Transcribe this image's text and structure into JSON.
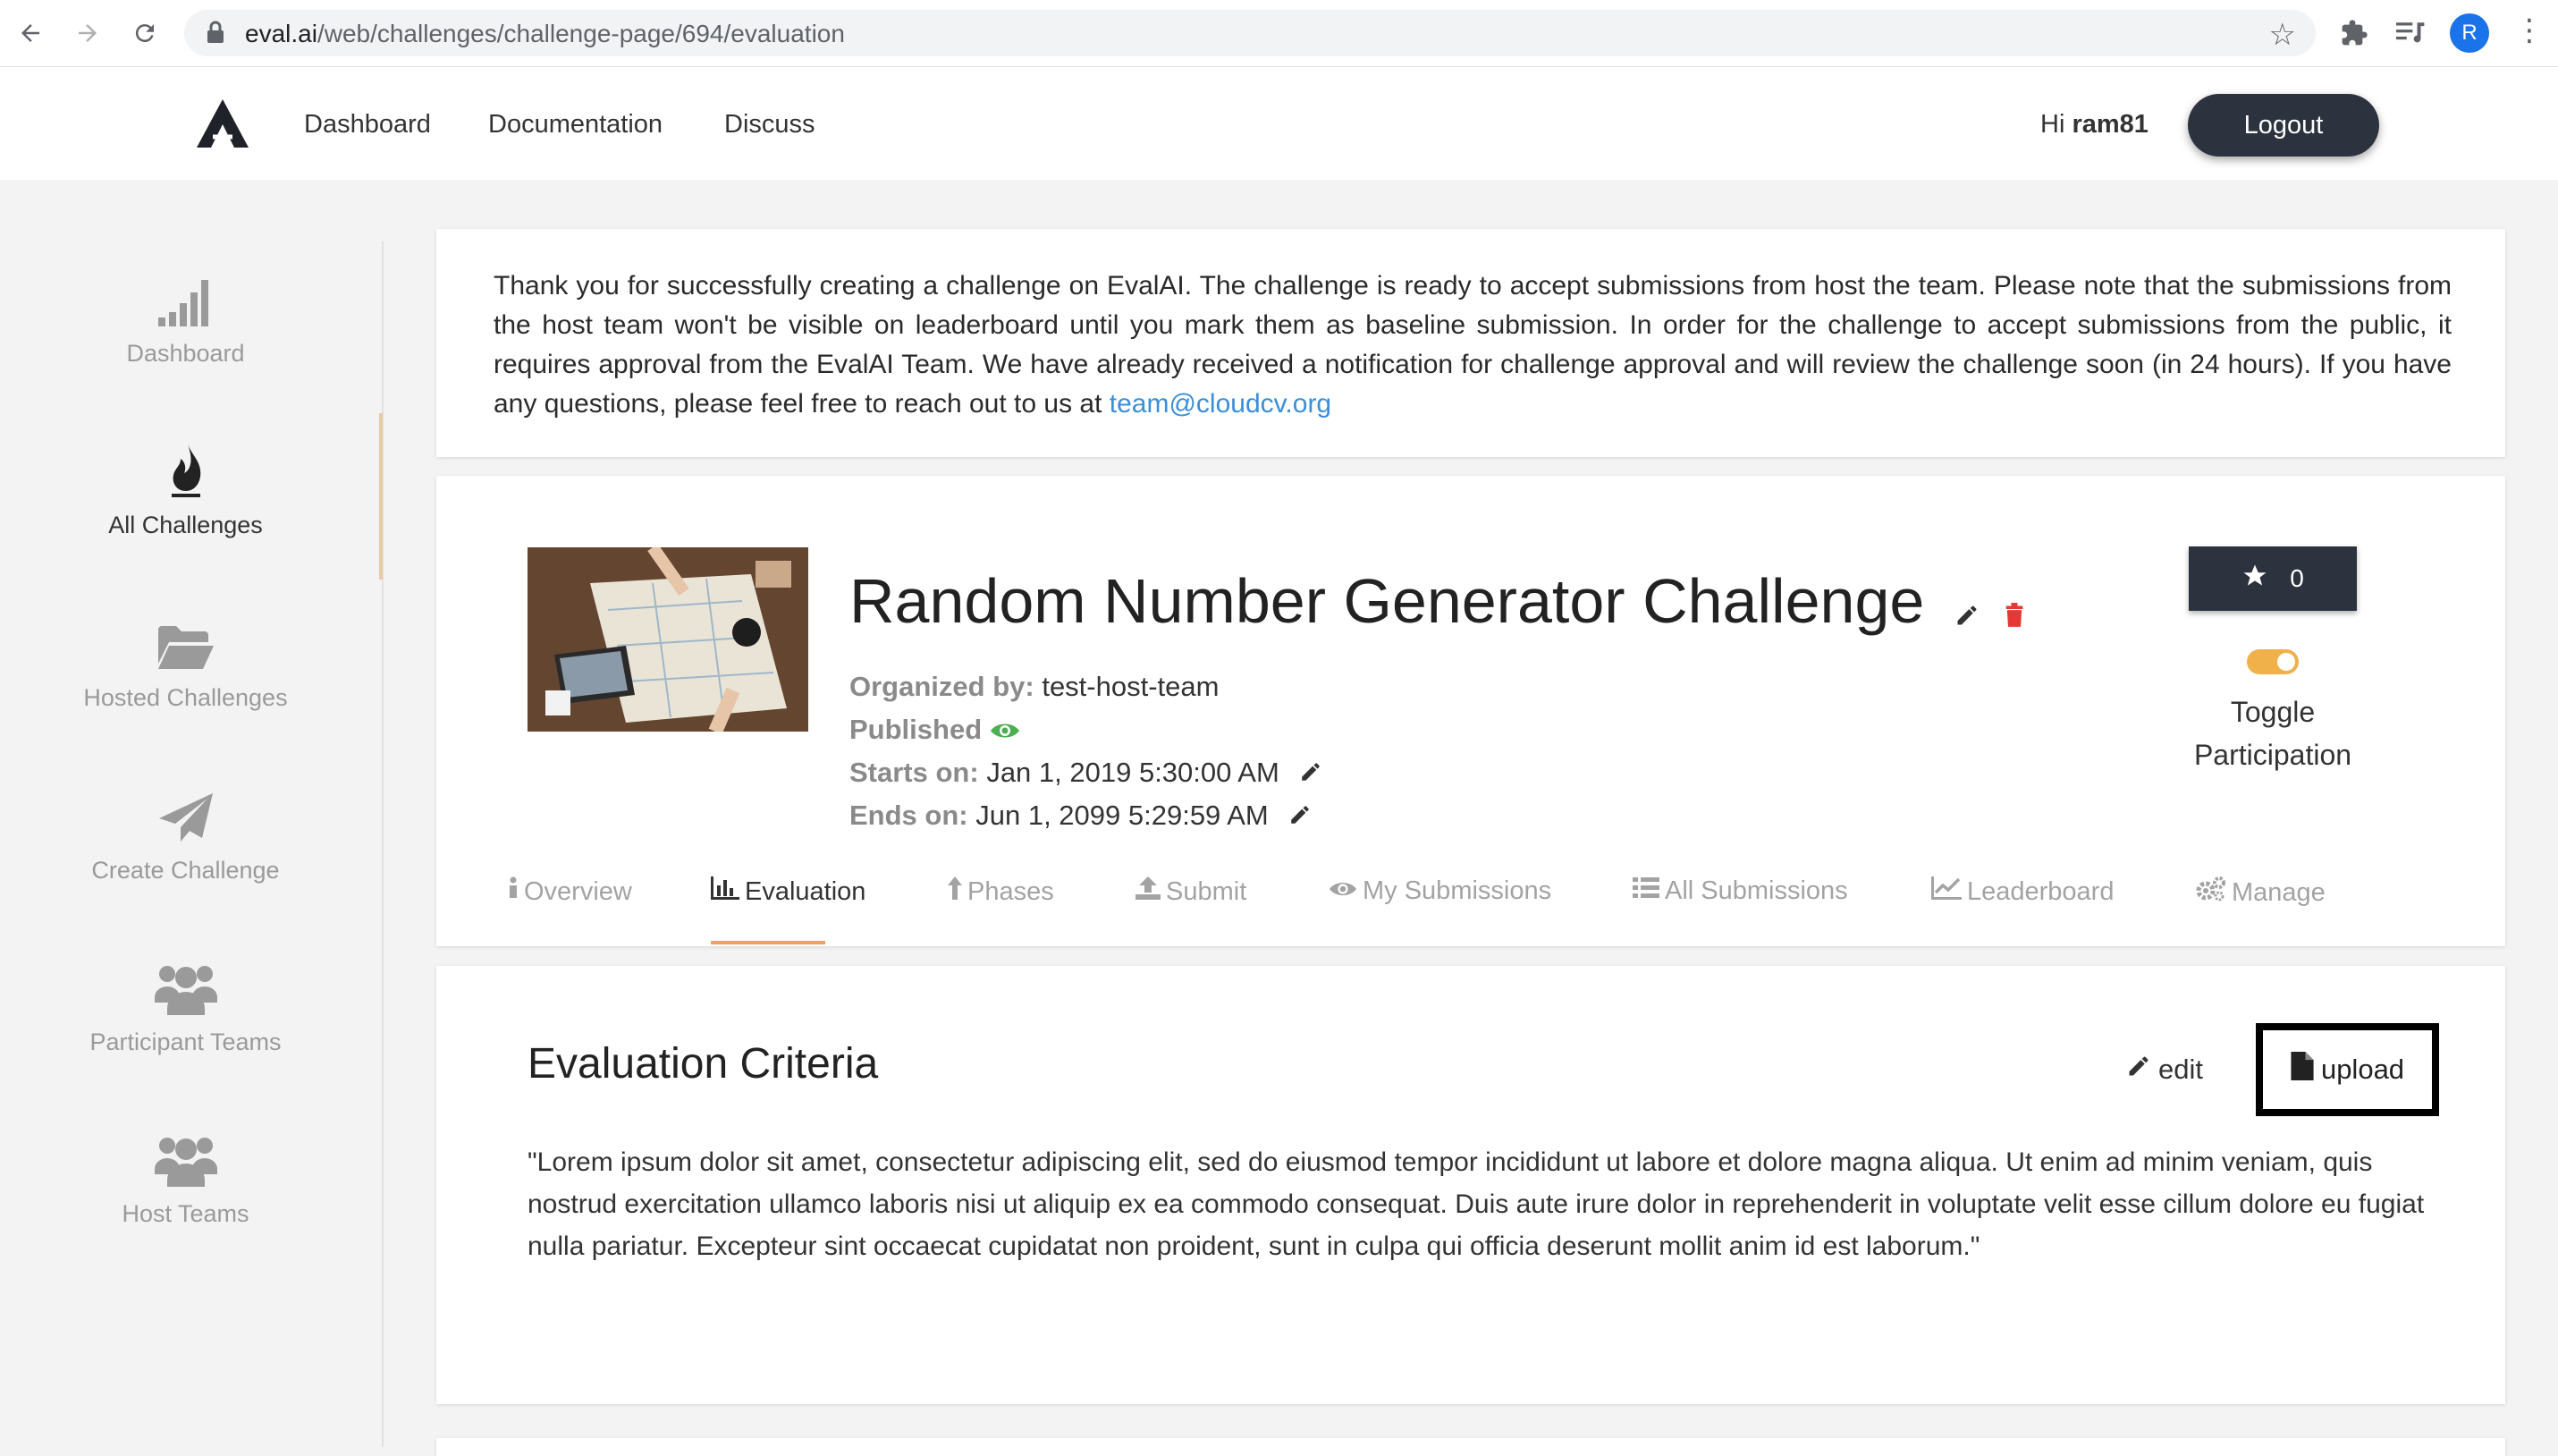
{
  "browser": {
    "url_host": "eval.ai",
    "url_path": "/web/challenges/challenge-page/694/evaluation",
    "profile_initial": "R"
  },
  "header": {
    "nav": [
      "Dashboard",
      "Documentation",
      "Discuss"
    ],
    "greeting_prefix": "Hi ",
    "username": "ram81",
    "logout_label": "Logout"
  },
  "sidebar": {
    "items": [
      {
        "label": "Dashboard",
        "icon": "signal-bars-icon"
      },
      {
        "label": "All Challenges",
        "icon": "fire-icon"
      },
      {
        "label": "Hosted Challenges",
        "icon": "folder-open-icon"
      },
      {
        "label": "Create Challenge",
        "icon": "paper-plane-icon"
      },
      {
        "label": "Participant Teams",
        "icon": "users-icon"
      },
      {
        "label": "Host Teams",
        "icon": "users-icon"
      }
    ]
  },
  "notice": {
    "text": "Thank you for successfully creating a challenge on EvalAI. The challenge is ready to accept submissions from host the team. Please note that the submissions from the host team won't be visible on leaderboard until you mark them as baseline submission. In order for the challenge to accept submissions from the public, it requires approval from the EvalAI Team. We have already received a notification for challenge approval and will review the challenge soon (in 24 hours). If you have any questions, please feel free to reach out to us at ",
    "email": "team@cloudcv.org"
  },
  "challenge": {
    "title": "Random Number Generator Challenge",
    "organized_by_key": "Organized by:",
    "organized_by": "test-host-team",
    "published_label": "Published",
    "starts_key": "Starts on:",
    "starts": "Jan 1, 2019 5:30:00 AM",
    "ends_key": "Ends on:",
    "ends": "Jun 1, 2099 5:29:59 AM",
    "star_count": "0",
    "toggle_line1": "Toggle",
    "toggle_line2": "Participation"
  },
  "tabs": [
    {
      "label": "Overview",
      "icon": "info-icon"
    },
    {
      "label": "Evaluation",
      "icon": "bar-chart-icon"
    },
    {
      "label": "Phases",
      "icon": "arrow-up-icon"
    },
    {
      "label": "Submit",
      "icon": "upload-icon"
    },
    {
      "label": "My Submissions",
      "icon": "eye-icon"
    },
    {
      "label": "All Submissions",
      "icon": "list-icon"
    },
    {
      "label": "Leaderboard",
      "icon": "line-chart-icon"
    },
    {
      "label": "Manage",
      "icon": "gears-icon"
    }
  ],
  "active_tab": "Evaluation",
  "evaluation": {
    "title": "Evaluation Criteria",
    "edit_label": "edit",
    "upload_label": "upload",
    "body": "\"Lorem ipsum dolor sit amet, consectetur adipiscing elit, sed do eiusmod tempor incididunt ut labore et dolore magna aliqua. Ut enim ad minim veniam, quis nostrud exercitation ullamco laboris nisi ut aliquip ex ea commodo consequat. Duis aute irure dolor in reprehenderit in voluptate velit esse cillum dolore eu fugiat nulla pariatur. Excepteur sint occaecat cupidatat non proident, sunt in culpa qui officia deserunt mollit anim id est laborum.\""
  },
  "colors": {
    "accent_orange": "#f0a35a",
    "dark_button": "#2c333e",
    "link_blue": "#3a8fd9",
    "published_green": "#4caf50",
    "delete_red": "#e53935"
  }
}
